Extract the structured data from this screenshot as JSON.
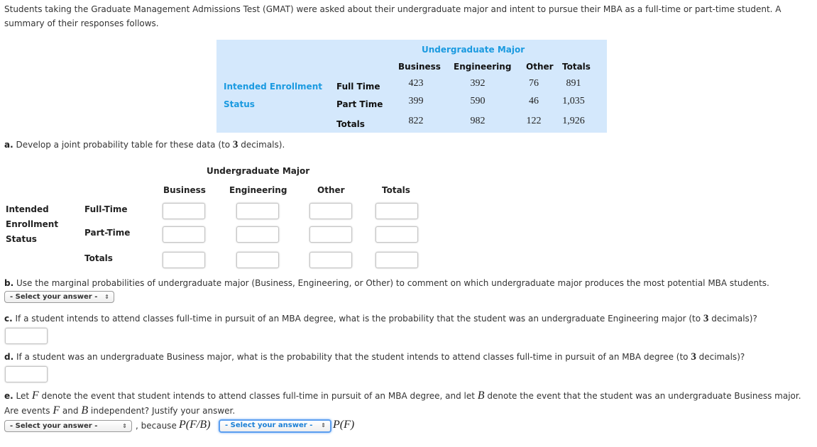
{
  "intro": {
    "line1": "Students taking the Graduate Management Admissions Test (GMAT) were asked about their undergraduate major and intent to pursue their MBA as a full-time or part-time student. A",
    "line2": "summary of their responses follows."
  },
  "given_table": {
    "column_group_title": "Undergraduate Major",
    "row_group_title_line1": "Intended Enrollment",
    "row_group_title_line2": "Status",
    "columns": [
      "Business",
      "Engineering",
      "Other",
      "Totals"
    ],
    "rows": [
      {
        "label": "Full Time",
        "values": [
          "423",
          "392",
          "76",
          "891"
        ]
      },
      {
        "label": "Part Time",
        "values": [
          "399",
          "590",
          "46",
          "1,035"
        ]
      },
      {
        "label": "Totals",
        "values": [
          "822",
          "982",
          "122",
          "1,926"
        ]
      }
    ]
  },
  "part_a": {
    "label": "a.",
    "text_before": " Develop a joint probability table for these data (to ",
    "decimals": "3",
    "text_after": " decimals).",
    "column_group_title": "Undergraduate Major",
    "columns": [
      "Business",
      "Engineering",
      "Other",
      "Totals"
    ],
    "row_group_title": [
      "Intended",
      "Enrollment",
      "Status"
    ],
    "rows": [
      {
        "label": "Full-Time",
        "values": [
          "",
          "",
          "",
          ""
        ]
      },
      {
        "label": "Part-Time",
        "values": [
          "",
          "",
          "",
          ""
        ]
      },
      {
        "label": "Totals",
        "values": [
          "",
          "",
          "",
          ""
        ]
      }
    ]
  },
  "part_b": {
    "label": "b.",
    "text": " Use the marginal probabilities of undergraduate major (Business, Engineering, or Other) to comment on which undergraduate major produces the most potential MBA students.",
    "select_value": "- Select your answer -"
  },
  "part_c": {
    "label": "c.",
    "text_before": " If a student intends to attend classes full-time in pursuit of an MBA degree, what is the probability that the student was an undergraduate Engineering major (to ",
    "decimals": "3",
    "text_after": " decimals)?",
    "input_value": ""
  },
  "part_d": {
    "label": "d.",
    "text_before": " If a student was an undergraduate Business major, what is the probability that the student intends to attend classes full-time in pursuit of an MBA degree (to ",
    "decimals": "3",
    "text_after": " decimals)?",
    "input_value": ""
  },
  "part_e": {
    "label": "e.",
    "t1": " Let ",
    "var_f": "F",
    "t2": " denote the event that student intends to attend classes full-time in pursuit of an MBA degree, and let ",
    "var_b": "B",
    "t3": " denote the event that the student was an undergraduate Business major.",
    "l2a": "Are events ",
    "l2b": " and ",
    "l2c": " independent? Justify your answer.",
    "select1_value": "- Select your answer -",
    "because": ", because ",
    "pfb": "P(F/B)",
    "select2_value": "- Select your answer -",
    "pf": "P(F)"
  }
}
